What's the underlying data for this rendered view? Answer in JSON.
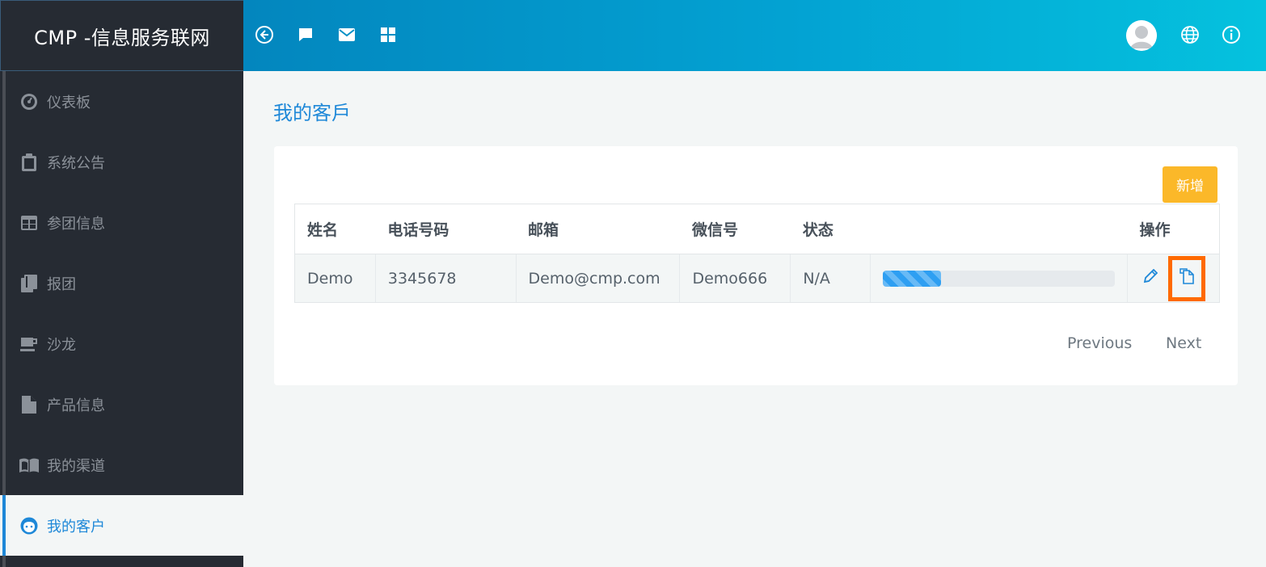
{
  "brand": {
    "title": "CMP -信息服务联网"
  },
  "topbar": {
    "icons": [
      "arrow-left-circle-icon",
      "chat-icon",
      "mail-icon",
      "grid-icon"
    ],
    "right_icons": [
      "avatar",
      "globe-icon",
      "info-icon"
    ]
  },
  "sidebar": {
    "items": [
      {
        "label": "仪表板",
        "icon": "dashboard-icon"
      },
      {
        "label": "系统公告",
        "icon": "clipboard-icon"
      },
      {
        "label": "参团信息",
        "icon": "table-icon"
      },
      {
        "label": "报团",
        "icon": "books-icon"
      },
      {
        "label": "沙龙",
        "icon": "coffee-icon"
      },
      {
        "label": "产品信息",
        "icon": "document-icon"
      },
      {
        "label": "我的渠道",
        "icon": "book-open-icon"
      },
      {
        "label": "我的客户",
        "icon": "face-icon",
        "active": true
      }
    ]
  },
  "main": {
    "title": "我的客戶",
    "add_label": "新增",
    "table": {
      "headers": [
        "姓名",
        "电话号码",
        "邮箱",
        "微信号",
        "状态",
        "",
        "操作"
      ],
      "rows": [
        {
          "name": "Demo",
          "phone": "3345678",
          "email": "Demo@cmp.com",
          "wechat": "Demo666",
          "status": "N/A",
          "progress": 0.25
        }
      ]
    },
    "pager": {
      "previous": "Previous",
      "next": "Next"
    }
  },
  "colors": {
    "accent": "#1e88d8",
    "sidebar_bg": "#262b33",
    "add_button": "#fbb829",
    "highlight": "#ff6a00"
  }
}
